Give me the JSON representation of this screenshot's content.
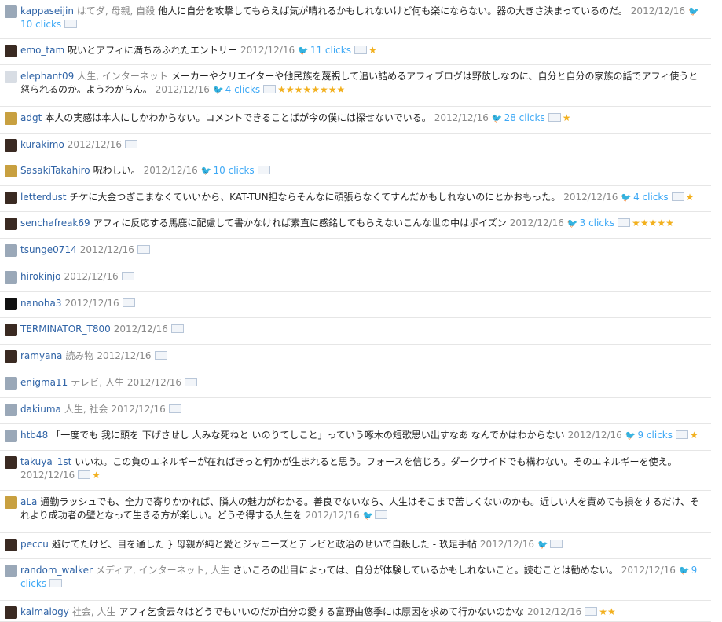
{
  "entries": [
    {
      "user": "kappaseijin",
      "tags": "はてダ, 母親, 自殺",
      "comment": "他人に自分を攻撃してもらえば気が晴れるかもしれないけど何も楽にならない。器の大きさ決まっているのだ。",
      "date": "2012/12/16",
      "tweet": true,
      "clicks": "10 clicks",
      "stars": ""
    },
    {
      "user": "emo_tam",
      "tags": "",
      "comment": "呪いとアフィに満ちあふれたエントリー",
      "date": "2012/12/16",
      "tweet": true,
      "clicks": "11 clicks",
      "stars": "★"
    },
    {
      "user": "elephant09",
      "tags": "人生, インターネット",
      "comment": "メーカーやクリエイターや他民族を蔑視して追い詰めるアフィブログは野放しなのに、自分と自分の家族の話でアフィ使うと怒られるのか。ようわからん。",
      "date": "2012/12/16",
      "tweet": true,
      "clicks": "4 clicks",
      "stars": "★★★★★★★★"
    },
    {
      "user": "adgt",
      "tags": "",
      "comment": "本人の実感は本人にしかわからない。コメントできることばが今の僕には探せないでいる。",
      "date": "2012/12/16",
      "tweet": true,
      "clicks": "28 clicks",
      "stars": "★"
    },
    {
      "user": "kurakimo",
      "tags": "",
      "comment": "",
      "date": "2012/12/16",
      "tweet": false,
      "clicks": "",
      "stars": ""
    },
    {
      "user": "SasakiTakahiro",
      "tags": "",
      "comment": "呪わしい。",
      "date": "2012/12/16",
      "tweet": true,
      "clicks": "10 clicks",
      "stars": ""
    },
    {
      "user": "letterdust",
      "tags": "",
      "comment": "チケに大金つぎこまなくていいから、KAT-TUN担ならそんなに頑張らなくてすんだかもしれないのにとかおもった。",
      "date": "2012/12/16",
      "tweet": true,
      "clicks": "4 clicks",
      "stars": "★"
    },
    {
      "user": "senchafreak69",
      "tags": "",
      "comment": "アフィに反応する馬鹿に配慮して書かなければ素直に感銘してもらえないこんな世の中はポイズン",
      "date": "2012/12/16",
      "tweet": true,
      "clicks": "3 clicks",
      "stars": "★★★★★"
    },
    {
      "user": "tsunge0714",
      "tags": "",
      "comment": "",
      "date": "2012/12/16",
      "tweet": false,
      "clicks": "",
      "stars": ""
    },
    {
      "user": "hirokinjo",
      "tags": "",
      "comment": "",
      "date": "2012/12/16",
      "tweet": false,
      "clicks": "",
      "stars": ""
    },
    {
      "user": "nanoha3",
      "tags": "",
      "comment": "",
      "date": "2012/12/16",
      "tweet": false,
      "clicks": "",
      "stars": ""
    },
    {
      "user": "TERMINATOR_T800",
      "tags": "",
      "comment": "",
      "date": "2012/12/16",
      "tweet": false,
      "clicks": "",
      "stars": ""
    },
    {
      "user": "ramyana",
      "tags": "読み物",
      "comment": "",
      "date": "2012/12/16",
      "tweet": false,
      "clicks": "",
      "stars": ""
    },
    {
      "user": "enigma11",
      "tags": "テレビ, 人生",
      "comment": "",
      "date": "2012/12/16",
      "tweet": false,
      "clicks": "",
      "stars": ""
    },
    {
      "user": "dakiuma",
      "tags": "人生, 社会",
      "comment": "",
      "date": "2012/12/16",
      "tweet": false,
      "clicks": "",
      "stars": ""
    },
    {
      "user": "htb48",
      "tags": "",
      "comment": "「一度でも 我に頭を 下げさせし 人みな死ねと いのりてしこと」っていう啄木の短歌思い出すなあ なんでかはわからない",
      "date": "2012/12/16",
      "tweet": true,
      "clicks": "9 clicks",
      "stars": "★"
    },
    {
      "user": "takuya_1st",
      "tags": "",
      "comment": "いいね。この負のエネルギーが在ればきっと何かが生まれると思う。フォースを信じろ。ダークサイドでも構わない。そのエネルギーを使え。",
      "date": "2012/12/16",
      "tweet": false,
      "clicks": "",
      "stars": "★"
    },
    {
      "user": "aLa",
      "tags": "",
      "comment": "通勤ラッシュでも、全力で寄りかかれば、隣人の魅力がわかる。善良でないなら、人生はそこまで苦しくないのかも。近しい人を責めても損をするだけ、それより成功者の壁となって生きる方が楽しい。どうぞ得する人生を",
      "date": "2012/12/16",
      "tweet": true,
      "clicks": "",
      "stars": ""
    },
    {
      "user": "peccu",
      "tags": "",
      "comment": "避けてたけど、目を通した } 母親が純と愛とジャニーズとテレビと政治のせいで自殺した - 玖足手帖",
      "date": "2012/12/16",
      "tweet": true,
      "clicks": "",
      "stars": ""
    },
    {
      "user": "random_walker",
      "tags": "メディア, インターネット, 人生",
      "comment": "さいころの出目によっては、自分が体験しているかもしれないこと。読むことは勧めない。",
      "date": "2012/12/16",
      "tweet": true,
      "clicks": "9 clicks",
      "stars": ""
    },
    {
      "user": "kalmalogy",
      "tags": "社会, 人生",
      "comment": "アフィ乞食云々はどうでもいいのだが自分の愛する富野由悠季には原因を求めて行かないのかな",
      "date": "2012/12/16",
      "tweet": false,
      "clicks": "",
      "stars": "★★"
    }
  ],
  "colors": {
    "user": "#2f63a6",
    "link": "#3fa9f5",
    "star": "#f2b01e",
    "meta": "#888888"
  },
  "icons": {
    "tweet": "bird-icon",
    "bookmark": "add-bookmark-icon",
    "star": "star-icon"
  }
}
